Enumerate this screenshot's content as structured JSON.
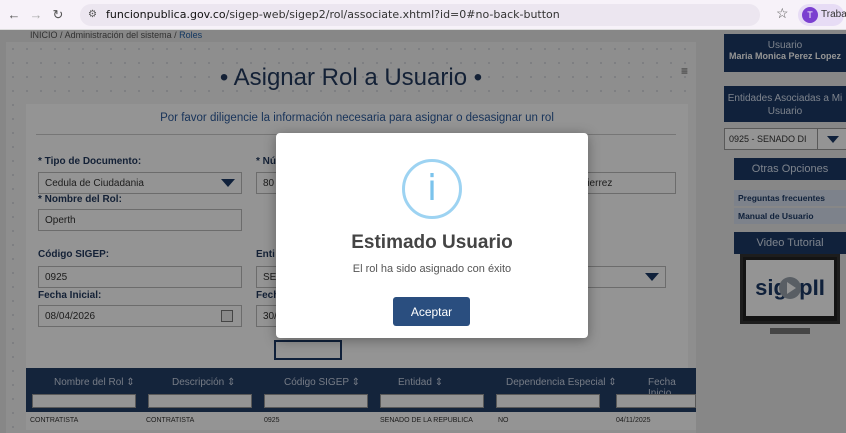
{
  "browser": {
    "url_domain": "funcionpublica.gov.co",
    "url_path": "/sigep-web/sigep2/rol/associate.xhtml?id=0#no-back-button",
    "profile_initial": "T",
    "profile_label": "Trabajo"
  },
  "breadcrumb": {
    "home": "INICIO",
    "sep": "/",
    "section": "Administración del sistema",
    "current": "Roles"
  },
  "page": {
    "title": "• Asignar Rol a Usuario •",
    "intro": "Por favor diligencie la información necesaria para asignar o desasignar un rol"
  },
  "form": {
    "tipo_documento": {
      "label": "* Tipo de Documento:",
      "value": "Cedula de Ciudadania"
    },
    "numero_documento": {
      "label": "* Nú",
      "value": "80"
    },
    "nombre_usuario": {
      "value": "utierrez"
    },
    "nombre_rol": {
      "label": "* Nombre del Rol:",
      "value": "Operth"
    },
    "codigo_sigep": {
      "label": "Código SIGEP:",
      "value": "0925"
    },
    "entidad": {
      "label": "Enti",
      "value": "SE"
    },
    "fecha_inicial": {
      "label": "Fecha Inicial:",
      "value": "08/04/2026"
    },
    "fecha_final": {
      "label": "Fech",
      "value": "30/"
    }
  },
  "table": {
    "headers": [
      "Nombre del Rol ⇕",
      "Descripción ⇕",
      "Código SIGEP ⇕",
      "Entidad ⇕",
      "Dependencia Especial ⇕",
      "Fecha Inicio"
    ],
    "row": [
      "CONTRATISTA",
      "CONTRATISTA",
      "0925",
      "SENADO DE LA REPUBLICA",
      "NO",
      "04/11/2025"
    ]
  },
  "sidebar": {
    "user_title": "Usuario",
    "user_name": "Maria Monica Perez Lopez",
    "entities_title": "Entidades Asociadas a Mi Usuario",
    "entity_selected": "0925 - SENADO DI",
    "options_title": "Otras Opciones",
    "links": [
      "Preguntas frecuentes",
      "Manual de Usuario"
    ],
    "video_title": "Video Tutorial",
    "video_logo": "sigepII"
  },
  "modal": {
    "icon": "i",
    "title": "Estimado Usuario",
    "message": "El rol ha sido asignado con éxito",
    "button": "Aceptar"
  }
}
